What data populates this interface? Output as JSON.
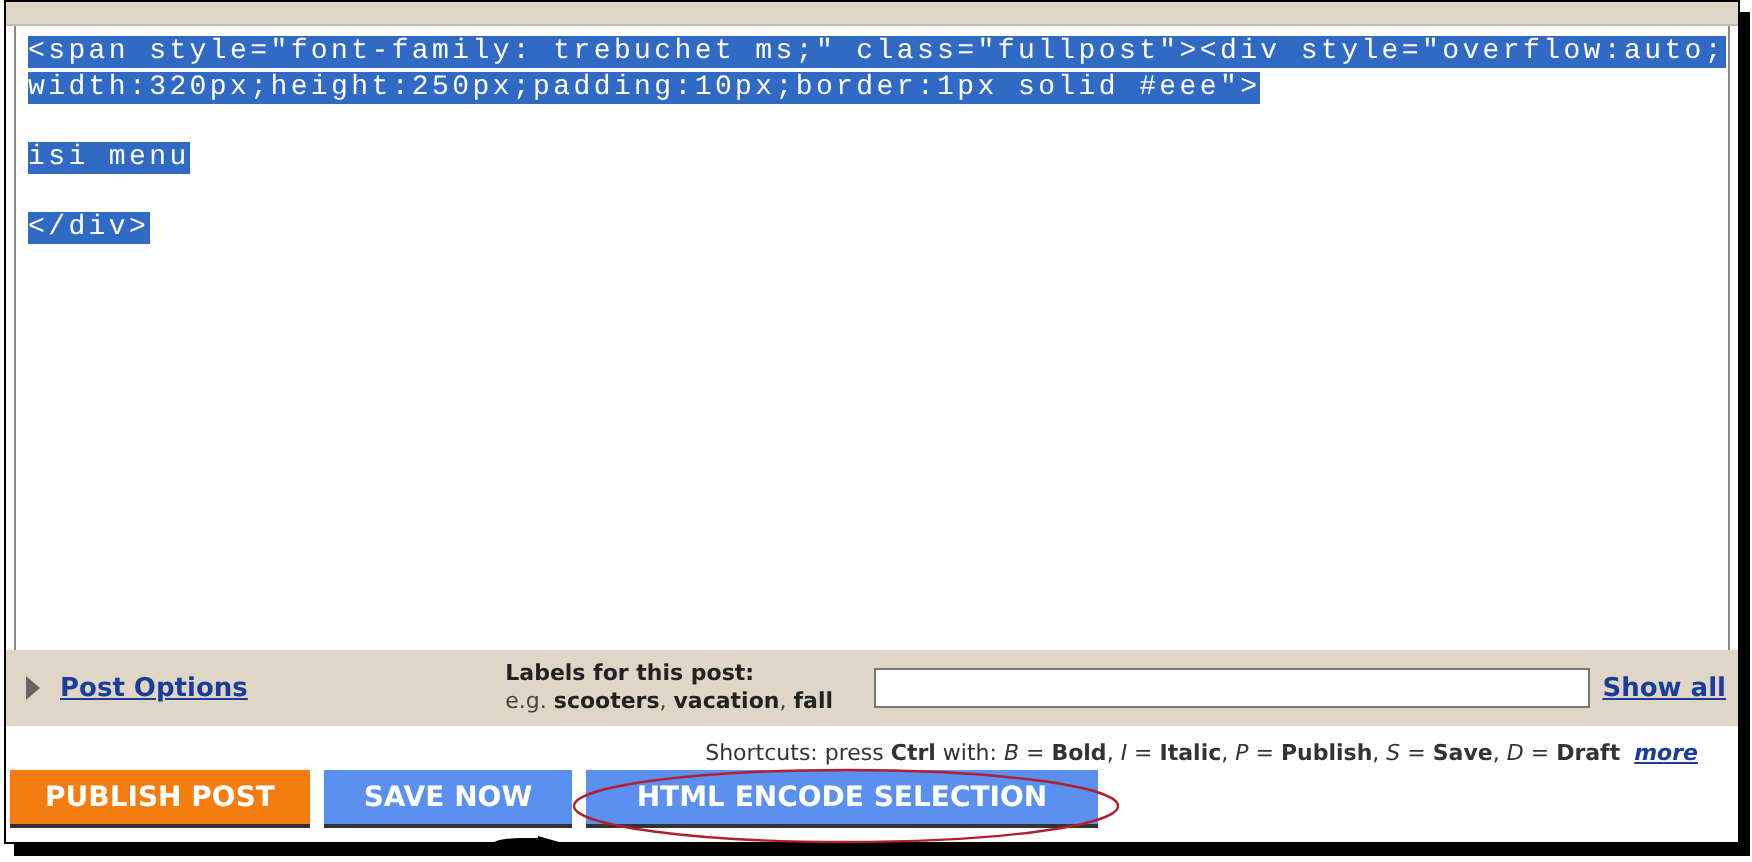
{
  "editor": {
    "paragraphs": [
      [
        "<span style=\"font-family: trebuchet ms;\" class=\"fullpost\"><div style=\"overflow:auto;",
        "width:320px;height:250px;padding:10px;border:1px solid #eee\">"
      ],
      [
        "isi menu"
      ],
      [
        "</div>"
      ]
    ],
    "selected": true
  },
  "options_bar": {
    "post_options": "Post Options",
    "labels_title": "Labels for this post:",
    "labels_hint": "e.g. **scooters**, **vacation**, **fall**",
    "show_all": "Show all"
  },
  "shortcuts": {
    "text": "Shortcuts: press **Ctrl** with: *B* = **Bold**, *I* = **Italic**, *P* = **Publish**, *S* = **Save**, *D* = **Draft**",
    "more": "more"
  },
  "buttons": [
    {
      "label": "PUBLISH POST",
      "kind": "publish"
    },
    {
      "label": "SAVE NOW",
      "kind": "save"
    },
    {
      "label": "HTML ENCODE SELECTION",
      "kind": "encode"
    }
  ]
}
